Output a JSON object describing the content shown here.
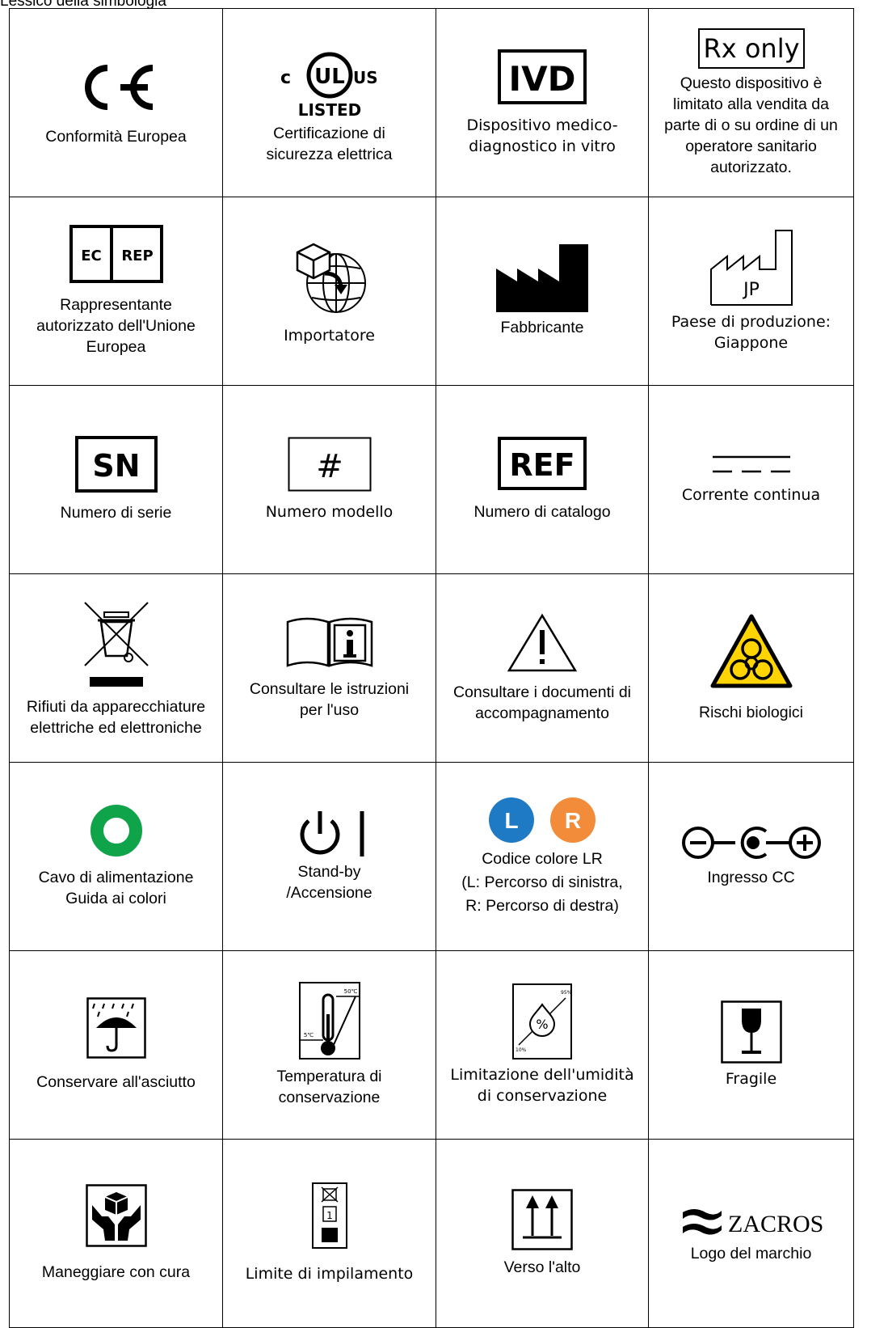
{
  "caption": "Lessico della simbologia",
  "symbols": {
    "ce": {
      "label": [
        "Conformità Europea"
      ]
    },
    "ul": {
      "label": [
        "Certificazione di",
        "sicurezza elettrica"
      ],
      "icon_text": [
        "c",
        "UL",
        "US",
        "LISTED"
      ]
    },
    "ivd": {
      "label": [
        "Dispositivo medico-",
        "diagnostico in vitro"
      ],
      "icon_text": "IVD"
    },
    "rx": {
      "label": [
        "Questo dispositivo è",
        "limitato alla vendita da",
        "parte di o su ordine di un",
        "operatore sanitario",
        "autorizzato."
      ],
      "icon_text": "Rx only"
    },
    "ecrep": {
      "label": [
        "Rappresentante",
        "autorizzato dell'Unione",
        "Europea"
      ],
      "icon_text": [
        "EC",
        "REP"
      ]
    },
    "importer": {
      "label": [
        "Importatore"
      ]
    },
    "manufacturer": {
      "label": [
        "Fabbricante"
      ]
    },
    "country": {
      "label": [
        "Paese di produzione:",
        "Giappone"
      ],
      "icon_text": "JP"
    },
    "sn": {
      "label": [
        "Numero di serie"
      ],
      "icon_text": "SN"
    },
    "model": {
      "label": [
        "Numero modello"
      ],
      "icon_text": "#"
    },
    "ref": {
      "label": [
        "Numero di catalogo"
      ],
      "icon_text": "REF"
    },
    "dc": {
      "label": [
        "Corrente continua"
      ]
    },
    "weee": {
      "label": [
        "Rifiuti da apparecchiature",
        "elettriche ed elettroniche"
      ]
    },
    "ifu": {
      "label": [
        "Consultare le istruzioni",
        "per l'uso"
      ]
    },
    "caution": {
      "label": [
        "Consultare i documenti di",
        "accompagnamento"
      ]
    },
    "biohazard": {
      "label": [
        "Rischi biologici"
      ]
    },
    "power_cable": {
      "label": [
        "Cavo di alimentazione",
        "Guida ai colori"
      ],
      "color": "#0fa34a"
    },
    "standby": {
      "label": [
        "Stand-by",
        "/Accensione"
      ]
    },
    "lr": {
      "label": [
        "Codice colore LR",
        "(L: Percorso di sinistra,",
        "R: Percorso di destra)"
      ],
      "left_text": "L",
      "right_text": "R",
      "left_color": "#1f7ac6",
      "right_color": "#f28c3a"
    },
    "dc_in": {
      "label": [
        "Ingresso CC"
      ]
    },
    "dry": {
      "label": [
        "Conservare all'asciutto"
      ]
    },
    "temp": {
      "label": [
        "Temperatura di",
        "conservazione"
      ],
      "icon_text": [
        "50℃",
        "5℃"
      ]
    },
    "humidity": {
      "label": [
        "Limitazione dell'umidità",
        "di conservazione"
      ],
      "icon_text": [
        "%",
        "95%",
        "10%"
      ]
    },
    "fragile": {
      "label": [
        "Fragile"
      ]
    },
    "care": {
      "label": [
        "Maneggiare con cura"
      ]
    },
    "stack": {
      "label": [
        "Limite di impilamento"
      ],
      "icon_text": "1"
    },
    "up": {
      "label": [
        "Verso l'alto"
      ]
    },
    "logo": {
      "label": [
        "Logo del marchio"
      ],
      "icon_text": "ZACROS"
    }
  }
}
